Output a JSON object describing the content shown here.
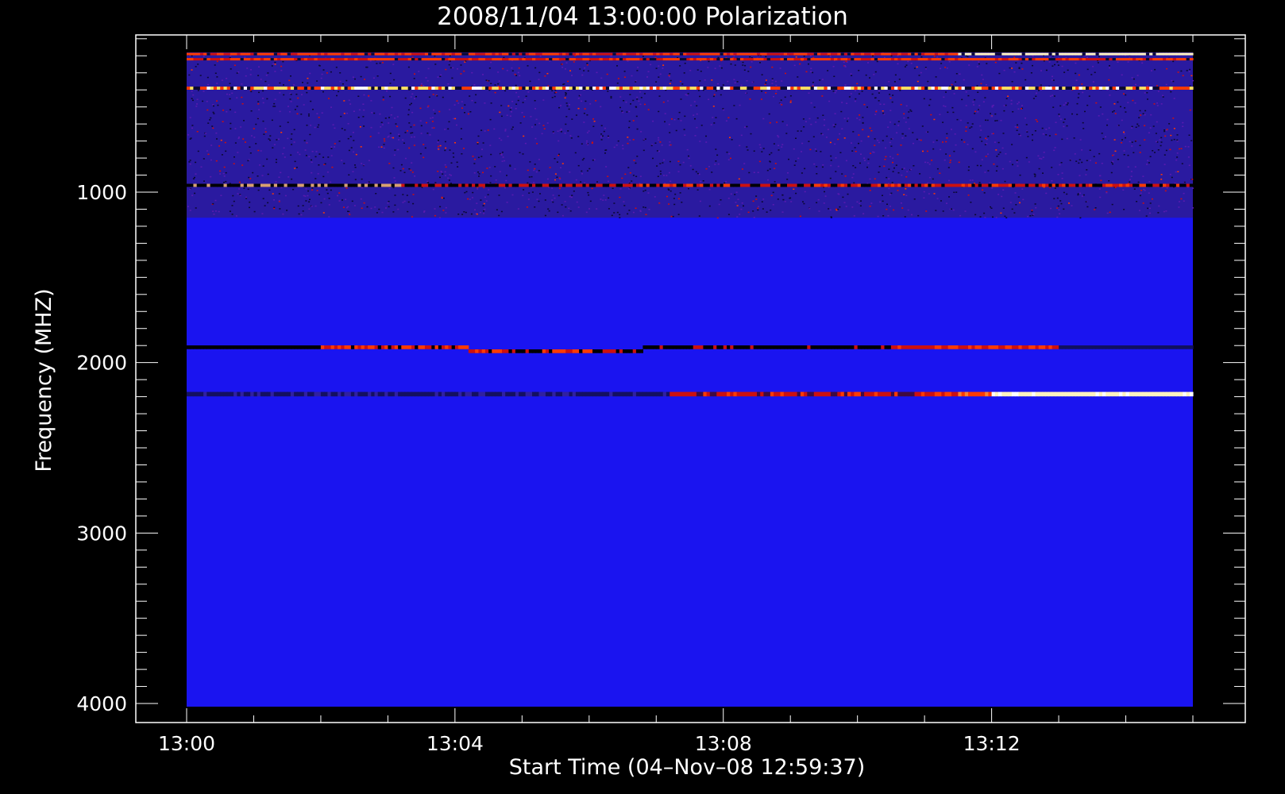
{
  "chart_data": {
    "type": "heatmap",
    "title": "2008/11/04 13:00:00 Polarization",
    "xlabel": "Start Time (04–Nov–08 12:59:37)",
    "ylabel": "Frequency (MHZ)",
    "x_ticks": [
      "13:00",
      "13:04",
      "13:08",
      "13:12"
    ],
    "x_tick_minutes": [
      0,
      4,
      8,
      12
    ],
    "xlim_minutes": [
      0,
      15.0
    ],
    "y_ticks": [
      1000,
      2000,
      3000,
      4000
    ],
    "ylim": [
      100,
      4000
    ],
    "y_reversed": true,
    "colormap": {
      "background": "#1a14f0",
      "dark": "#000000",
      "mid": "#cc1010",
      "high": "#ff3a00",
      "peak": "#fff2c0"
    },
    "noise_band": {
      "freq_from": 100,
      "freq_to": 1150
    },
    "features": [
      {
        "freq": 190,
        "width": 8,
        "t_start": 0.0,
        "t_end": 15.0,
        "level": "high",
        "peak_from": 11.5
      },
      {
        "freq": 220,
        "width": 5,
        "t_start": 0.0,
        "t_end": 15.0,
        "level": "high"
      },
      {
        "freq": 390,
        "width": 18,
        "t_start": 0.0,
        "t_end": 15.0,
        "level": "mixed"
      },
      {
        "freq": 960,
        "width": 18,
        "t_start": 0.0,
        "t_end": 15.0,
        "level": "dark_then_mid"
      },
      {
        "freq": 1910,
        "width": 22,
        "t_start": 0.0,
        "t_end": 15.0,
        "level": "burst_low"
      },
      {
        "freq": 2185,
        "width": 26,
        "t_start": 0.0,
        "t_end": 15.0,
        "level": "burst_high"
      }
    ]
  }
}
